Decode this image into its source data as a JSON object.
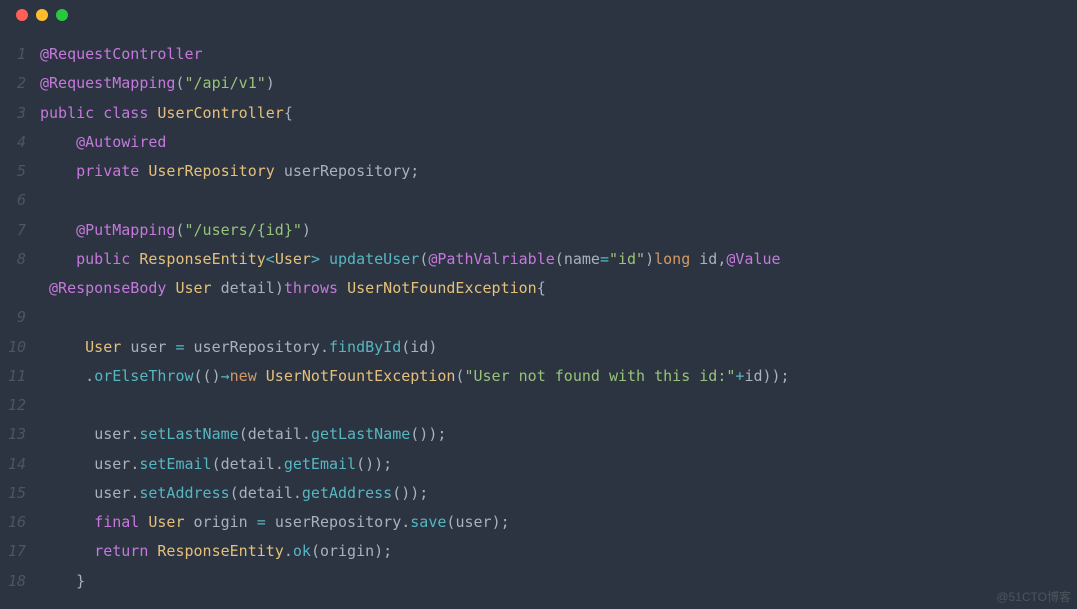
{
  "window": {
    "traffic": [
      "red",
      "yellow",
      "green"
    ]
  },
  "watermark": "@51CTO博客",
  "lines": [
    {
      "n": "1",
      "tokens": [
        [
          "ann",
          "@RequestController"
        ]
      ]
    },
    {
      "n": "2",
      "tokens": [
        [
          "ann",
          "@RequestMapping"
        ],
        [
          "punct",
          "("
        ],
        [
          "str",
          "\"/api/v1\""
        ],
        [
          "punct",
          ")"
        ]
      ]
    },
    {
      "n": "3",
      "tokens": [
        [
          "kw",
          "public"
        ],
        [
          "punct",
          " "
        ],
        [
          "kw",
          "class"
        ],
        [
          "punct",
          " "
        ],
        [
          "type",
          "UserController"
        ],
        [
          "punct",
          "{"
        ]
      ]
    },
    {
      "n": "4",
      "tokens": [
        [
          "punct",
          "    "
        ],
        [
          "ann",
          "@Autowired"
        ]
      ]
    },
    {
      "n": "5",
      "tokens": [
        [
          "punct",
          "    "
        ],
        [
          "kw",
          "private"
        ],
        [
          "punct",
          " "
        ],
        [
          "type",
          "UserRepository"
        ],
        [
          "punct",
          " "
        ],
        [
          "ident",
          "userRepository"
        ],
        [
          "punct",
          ";"
        ]
      ]
    },
    {
      "n": "6",
      "tokens": []
    },
    {
      "n": "7",
      "tokens": [
        [
          "punct",
          "    "
        ],
        [
          "ann",
          "@PutMapping"
        ],
        [
          "punct",
          "("
        ],
        [
          "str",
          "\"/users/{id}\""
        ],
        [
          "punct",
          ")"
        ]
      ]
    },
    {
      "n": "8",
      "tokens": [
        [
          "punct",
          "    "
        ],
        [
          "kw",
          "public"
        ],
        [
          "punct",
          " "
        ],
        [
          "type",
          "ResponseEntity"
        ],
        [
          "op",
          "<"
        ],
        [
          "type",
          "User"
        ],
        [
          "op",
          ">"
        ],
        [
          "punct",
          " "
        ],
        [
          "fn",
          "updateUser"
        ],
        [
          "punct",
          "("
        ],
        [
          "ann",
          "@PathValriable"
        ],
        [
          "punct",
          "("
        ],
        [
          "ident",
          "name"
        ],
        [
          "op",
          "="
        ],
        [
          "str",
          "\"id\""
        ],
        [
          "punct",
          ")"
        ],
        [
          "const",
          "long"
        ],
        [
          "punct",
          " "
        ],
        [
          "ident",
          "id"
        ],
        [
          "punct",
          ","
        ],
        [
          "ann",
          "@Value"
        ]
      ]
    },
    {
      "n": "",
      "tokens": [
        [
          "punct",
          " "
        ],
        [
          "ann",
          "@ResponseBody"
        ],
        [
          "punct",
          " "
        ],
        [
          "type",
          "User"
        ],
        [
          "punct",
          " "
        ],
        [
          "ident",
          "detail"
        ],
        [
          "punct",
          ")"
        ],
        [
          "kw",
          "throws"
        ],
        [
          "punct",
          " "
        ],
        [
          "type",
          "UserNotFoundException"
        ],
        [
          "punct",
          "{"
        ]
      ]
    },
    {
      "n": "9",
      "tokens": []
    },
    {
      "n": "10",
      "tokens": [
        [
          "punct",
          "     "
        ],
        [
          "type",
          "User"
        ],
        [
          "punct",
          " "
        ],
        [
          "ident",
          "user"
        ],
        [
          "punct",
          " "
        ],
        [
          "op",
          "="
        ],
        [
          "punct",
          " "
        ],
        [
          "ident",
          "userRepository"
        ],
        [
          "punct",
          "."
        ],
        [
          "fn",
          "findById"
        ],
        [
          "punct",
          "("
        ],
        [
          "ident",
          "id"
        ],
        [
          "punct",
          ")"
        ]
      ]
    },
    {
      "n": "11",
      "tokens": [
        [
          "punct",
          "     ."
        ],
        [
          "fn",
          "orElseThrow"
        ],
        [
          "punct",
          "(()"
        ],
        [
          "op",
          "→"
        ],
        [
          "const",
          "new"
        ],
        [
          "punct",
          " "
        ],
        [
          "type",
          "UserNotFountException"
        ],
        [
          "punct",
          "("
        ],
        [
          "str",
          "\"User not found with this id:\""
        ],
        [
          "op",
          "+"
        ],
        [
          "ident",
          "id"
        ],
        [
          "punct",
          "));"
        ]
      ]
    },
    {
      "n": "12",
      "tokens": []
    },
    {
      "n": "13",
      "tokens": [
        [
          "punct",
          "      "
        ],
        [
          "ident",
          "user"
        ],
        [
          "punct",
          "."
        ],
        [
          "fn",
          "setLastName"
        ],
        [
          "punct",
          "("
        ],
        [
          "ident",
          "detail"
        ],
        [
          "punct",
          "."
        ],
        [
          "fn",
          "getLastName"
        ],
        [
          "punct",
          "());"
        ]
      ]
    },
    {
      "n": "14",
      "tokens": [
        [
          "punct",
          "      "
        ],
        [
          "ident",
          "user"
        ],
        [
          "punct",
          "."
        ],
        [
          "fn",
          "setEmail"
        ],
        [
          "punct",
          "("
        ],
        [
          "ident",
          "detail"
        ],
        [
          "punct",
          "."
        ],
        [
          "fn",
          "getEmail"
        ],
        [
          "punct",
          "());"
        ]
      ]
    },
    {
      "n": "15",
      "tokens": [
        [
          "punct",
          "      "
        ],
        [
          "ident",
          "user"
        ],
        [
          "punct",
          "."
        ],
        [
          "fn",
          "setAddress"
        ],
        [
          "punct",
          "("
        ],
        [
          "ident",
          "detail"
        ],
        [
          "punct",
          "."
        ],
        [
          "fn",
          "getAddress"
        ],
        [
          "punct",
          "());"
        ]
      ]
    },
    {
      "n": "16",
      "tokens": [
        [
          "punct",
          "      "
        ],
        [
          "kw",
          "final"
        ],
        [
          "punct",
          " "
        ],
        [
          "type",
          "User"
        ],
        [
          "punct",
          " "
        ],
        [
          "ident",
          "origin"
        ],
        [
          "punct",
          " "
        ],
        [
          "op",
          "="
        ],
        [
          "punct",
          " "
        ],
        [
          "ident",
          "userRepository"
        ],
        [
          "punct",
          "."
        ],
        [
          "fn",
          "save"
        ],
        [
          "punct",
          "("
        ],
        [
          "ident",
          "user"
        ],
        [
          "punct",
          ");"
        ]
      ]
    },
    {
      "n": "17",
      "tokens": [
        [
          "punct",
          "      "
        ],
        [
          "kw",
          "return"
        ],
        [
          "punct",
          " "
        ],
        [
          "type",
          "ResponseEntity"
        ],
        [
          "punct",
          "."
        ],
        [
          "fn",
          "ok"
        ],
        [
          "punct",
          "("
        ],
        [
          "ident",
          "origin"
        ],
        [
          "punct",
          ");"
        ]
      ]
    },
    {
      "n": "18",
      "tokens": [
        [
          "punct",
          "    }"
        ]
      ]
    }
  ]
}
